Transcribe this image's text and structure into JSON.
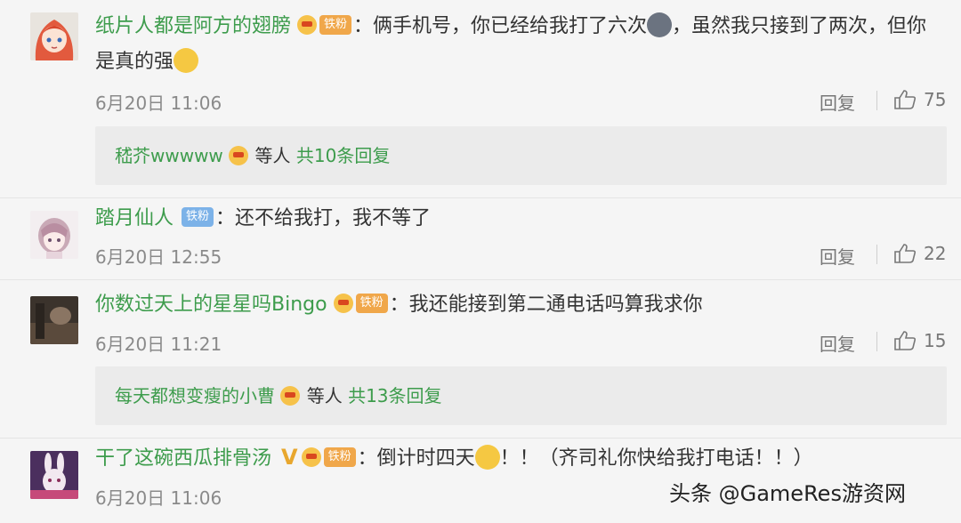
{
  "comments": [
    {
      "username": "纸片人都是阿方的翅膀",
      "badge": "铁粉",
      "text_1": "：俩手机号，你已经给我打了六次",
      "text_2": "，虽然我只接到了两次，但你",
      "text_3": "是真的强",
      "time": "6月20日 11:06",
      "reply_label": "回复",
      "likes": "75",
      "replies_user": "嵇芥wwwww",
      "replies_etc": "等人",
      "replies_count": "共10条回复"
    },
    {
      "username": "踏月仙人",
      "badge": "铁粉",
      "text_1": "：还不给我打，我不等了",
      "time": "6月20日 12:55",
      "reply_label": "回复",
      "likes": "22"
    },
    {
      "username": "你数过天上的星星吗Bingo",
      "badge": "铁粉",
      "text_1": "：我还能接到第二通电话吗算我求你",
      "time": "6月20日 11:21",
      "reply_label": "回复",
      "likes": "15",
      "replies_user": "每天都想变瘦的小曹",
      "replies_etc": "等人",
      "replies_count": "共13条回复"
    },
    {
      "username": "干了这碗西瓜排骨汤",
      "verified": "V",
      "badge": "铁粉",
      "text_1": "：倒计时四天",
      "text_2": "！！（齐司礼你快给我打电话！！）",
      "time": "6月20日 11:06"
    }
  ],
  "watermark": "头条 @GameRes游资网",
  "colors": {
    "username": "#3d9c4c",
    "badge_gold": "#f0a74a",
    "badge_blue": "#7cb2e8",
    "background": "#f5f5f5",
    "reply_box": "#ebebeb"
  },
  "icons": [
    "fan-icon",
    "thumbs-up-icon",
    "emoji-icon"
  ]
}
